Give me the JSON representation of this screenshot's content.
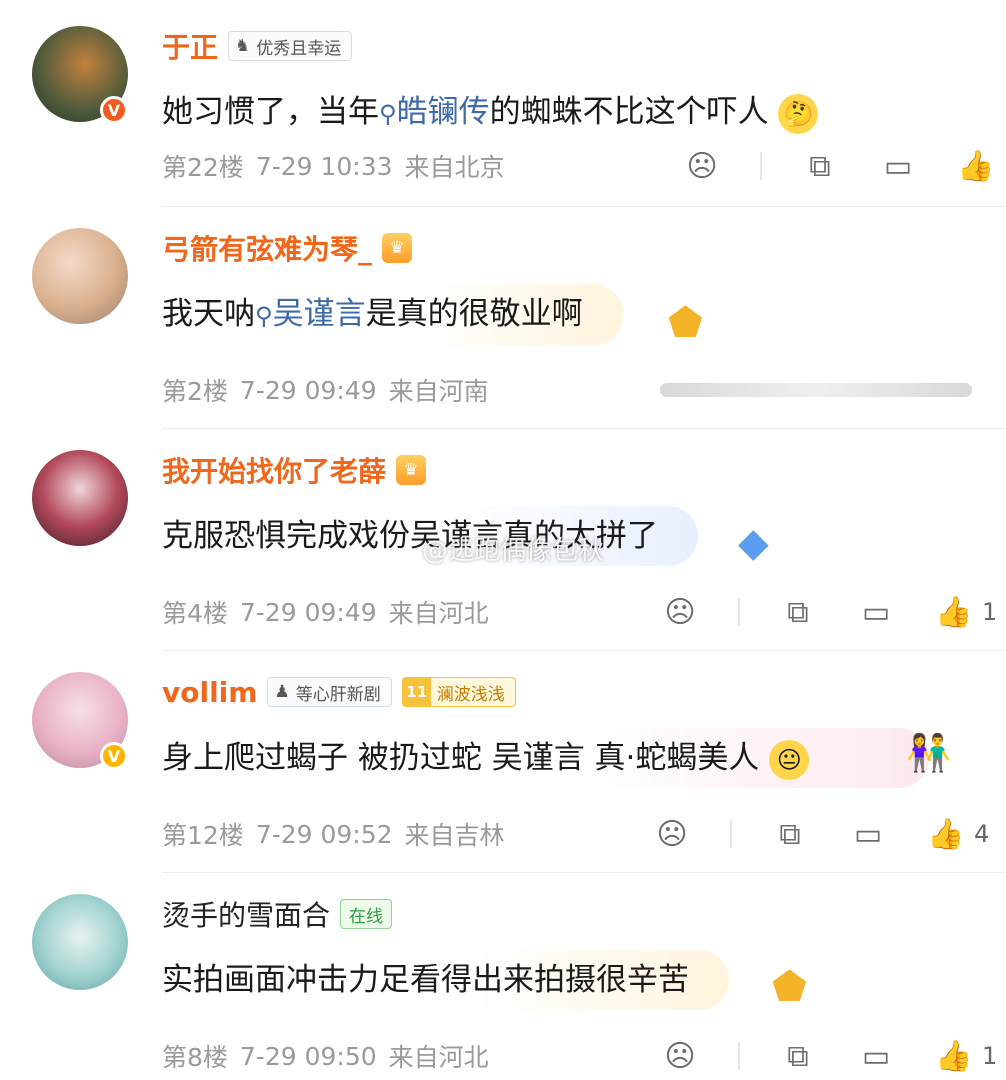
{
  "comments": [
    {
      "username": "于正",
      "badge": "优秀且幸运",
      "verified": "orange",
      "text_before": "她习惯了，当年",
      "link": "皓镧传",
      "text_after": "的蜘蛛不比这个吓人",
      "meta_floor": "第22楼",
      "meta_time": "7-29 10:33",
      "meta_location": "来自北京",
      "likes": ""
    },
    {
      "username": "弓箭有弦难为琴_",
      "text_before": "我天呐",
      "link": "吴谨言",
      "text_after": "是真的很敬业啊",
      "meta_floor": "第2楼",
      "meta_time": "7-29 09:49",
      "meta_location": "来自河南"
    },
    {
      "username": "我开始找你了老薛",
      "text": "克服恐惧完成戏份吴谨言真的太拼了",
      "meta_floor": "第4楼",
      "meta_time": "7-29 09:49",
      "meta_location": "来自河北",
      "likes": "1"
    },
    {
      "username": "vollim",
      "badge": "等心肝新剧",
      "fan_level": "11",
      "fan_badge": "澜波浅浅",
      "verified": "gold",
      "text": "身上爬过蝎子 被扔过蛇 吴谨言 真·蛇蝎美人",
      "meta_floor": "第12楼",
      "meta_time": "7-29 09:52",
      "meta_location": "来自吉林",
      "likes": "4"
    },
    {
      "username": "烫手的雪面合",
      "online": "在线",
      "text": "实拍画面冲击力足看得出来拍摄很辛苦",
      "meta_floor": "第8楼",
      "meta_time": "7-29 09:50",
      "meta_location": "来自河北",
      "likes": "1"
    }
  ],
  "watermark": "@逃跑偶像包秋",
  "icons": {
    "dislike": "sad-face-icon",
    "share": "share-icon",
    "comment": "comment-icon",
    "like": "thumbs-up-icon"
  }
}
